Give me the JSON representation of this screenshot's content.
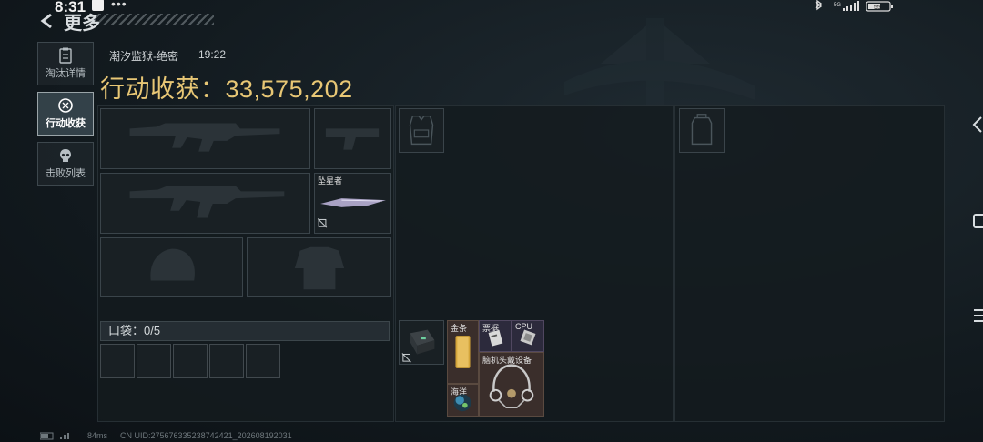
{
  "status_bar": {
    "time": "8:31",
    "dots": "•••",
    "network": "5G",
    "battery": "55"
  },
  "header": {
    "back_label": "更多"
  },
  "nav": {
    "items": [
      {
        "label": "淘汰详情",
        "icon": "clipboard-icon"
      },
      {
        "label": "行动收获",
        "icon": "loot-coin-icon",
        "active": true
      },
      {
        "label": "击败列表",
        "icon": "skull-icon"
      }
    ]
  },
  "match": {
    "map": "潮汐监狱-绝密",
    "time": "19:22",
    "loot_label": "行动收获：",
    "loot_value": "33,575,202"
  },
  "slots": {
    "melee_name": "坠星者",
    "pocket_label": "口袋：",
    "pocket_count": "0",
    "pocket_max": "/5"
  },
  "backpack_items": [
    {
      "label": "金条"
    },
    {
      "label": "票据"
    },
    {
      "label": "CPU"
    },
    {
      "label": "脑机头戴设备"
    },
    {
      "label": "海洋"
    }
  ],
  "footer": {
    "ping": "84ms",
    "uid": "CN UID:275676335238742421_202608192031"
  },
  "colors": {
    "accent_gold": "#e8c775",
    "background": "#0f151a"
  }
}
